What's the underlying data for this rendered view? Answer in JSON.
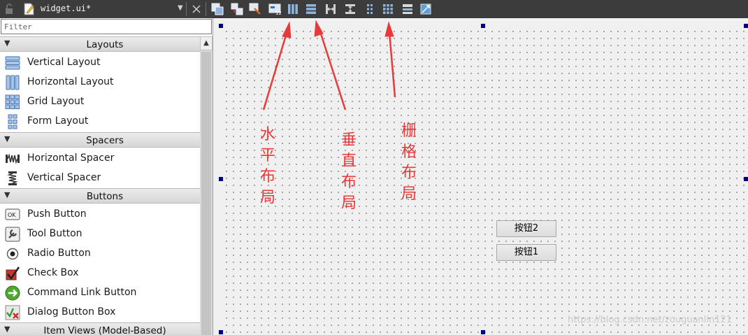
{
  "toolbar": {
    "file_title": "widget.ui*",
    "dropdown_icon": "chevron-down-icon",
    "close_icon": "close-icon"
  },
  "widget_box": {
    "filter_placeholder": "Filter",
    "categories": [
      {
        "title": "Layouts",
        "items": [
          "Vertical Layout",
          "Horizontal Layout",
          "Grid Layout",
          "Form Layout"
        ]
      },
      {
        "title": "Spacers",
        "items": [
          "Horizontal Spacer",
          "Vertical Spacer"
        ]
      },
      {
        "title": "Buttons",
        "items": [
          "Push Button",
          "Tool Button",
          "Radio Button",
          "Check Box",
          "Command Link Button",
          "Dialog Button Box"
        ]
      },
      {
        "title": "Item Views (Model-Based)",
        "items": []
      }
    ]
  },
  "form": {
    "button2_label": "按钮2",
    "button1_label": "按钮1"
  },
  "annotations": {
    "horizontal": "水平布局",
    "vertical": "垂直布局",
    "grid": "栅格布局",
    "color": "#e83a3a"
  },
  "watermark": "https://blog.csdn.net/zouguanlin121"
}
